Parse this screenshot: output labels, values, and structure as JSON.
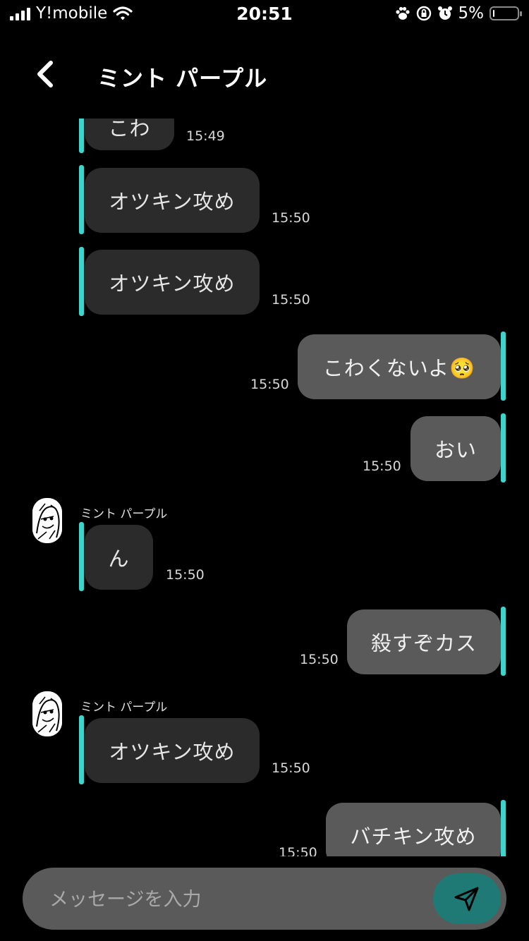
{
  "status": {
    "carrier": "Y!mobile",
    "time": "20:51",
    "battery": "5%",
    "battery_level": 0.05
  },
  "header": {
    "title": "ミント パープル"
  },
  "colors": {
    "accent": "#3ed4cc",
    "incoming_bubble": "#2b2b2b",
    "outgoing_bubble": "#5a5a5a",
    "send_button": "#1f7a76"
  },
  "messages": [
    {
      "text": "こわ",
      "time": "15:49",
      "direction": "in"
    },
    {
      "text": "オツキン攻め",
      "time": "15:50",
      "direction": "in"
    },
    {
      "text": "オツキン攻め",
      "time": "15:50",
      "direction": "in"
    },
    {
      "text": "こわくないよ🥺",
      "time": "15:50",
      "direction": "out"
    },
    {
      "text": "おい",
      "time": "15:50",
      "direction": "out"
    },
    {
      "sender": "ミント パープル",
      "text": "ん",
      "time": "15:50",
      "direction": "in"
    },
    {
      "text": "殺すぞカス",
      "time": "15:50",
      "direction": "out"
    },
    {
      "sender": "ミント パープル",
      "text": "オツキン攻め",
      "time": "15:50",
      "direction": "in"
    },
    {
      "text": "バチキン攻め",
      "time": "15:50",
      "direction": "out"
    }
  ],
  "composer": {
    "placeholder": "メッセージを入力",
    "value": ""
  }
}
